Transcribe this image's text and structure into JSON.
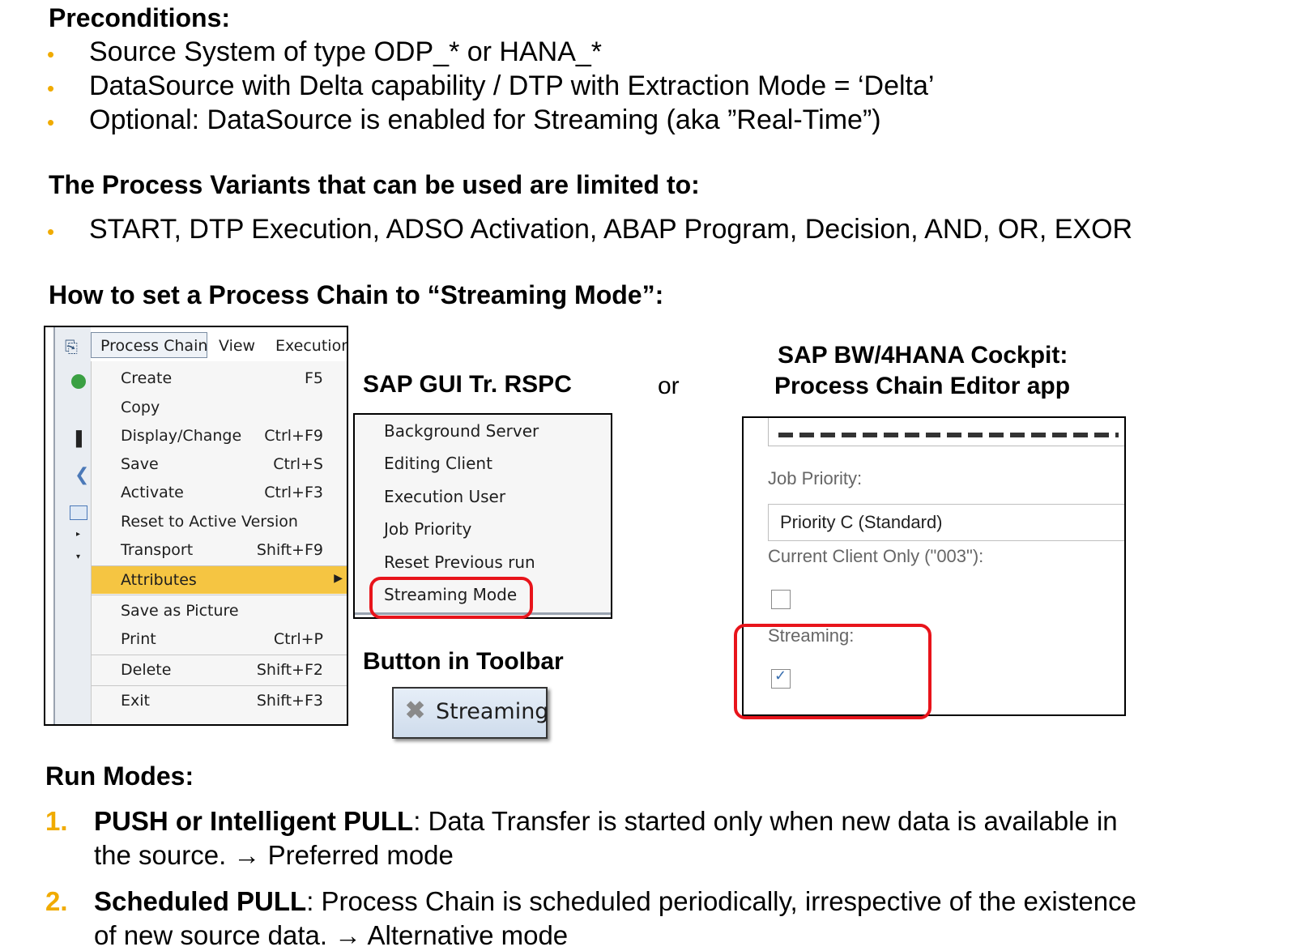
{
  "preconditions": {
    "heading": "Preconditions:",
    "items": [
      "Source System of type ODP_* or HANA_*",
      "DataSource with Delta capability /  DTP with Extraction Mode = ‘Delta’",
      "Optional: DataSource is enabled for Streaming (aka ”Real-Time”)"
    ]
  },
  "variants": {
    "heading": "The Process Variants that can be used are limited to:",
    "items": [
      "START, DTP Execution, ADSO Activation, ABAP Program, Decision, AND, OR, EXOR"
    ]
  },
  "how_to": {
    "heading": "How to set a Process Chain to “Streaming Mode”:"
  },
  "sap_gui": {
    "menubar": [
      "Process Chain",
      "View",
      "Execution"
    ],
    "menu_items": [
      {
        "label": "Create",
        "shortcut": "F5"
      },
      {
        "label": "Copy",
        "shortcut": ""
      },
      {
        "label": "Display/Change",
        "shortcut": "Ctrl+F9"
      },
      {
        "label": "Save",
        "shortcut": "Ctrl+S"
      },
      {
        "label": "Activate",
        "shortcut": "Ctrl+F3"
      },
      {
        "label": "Reset to Active Version",
        "shortcut": ""
      },
      {
        "label": "Transport",
        "shortcut": "Shift+F9"
      },
      {
        "label": "Attributes",
        "shortcut": ""
      },
      {
        "label": "Save as Picture",
        "shortcut": ""
      },
      {
        "label": "Print",
        "shortcut": "Ctrl+P"
      },
      {
        "label": "Delete",
        "shortcut": "Shift+F2"
      },
      {
        "label": "Exit",
        "shortcut": "Shift+F3"
      }
    ],
    "selected_item": "Attributes",
    "title": "SAP GUI Tr. RSPC",
    "submenu_items": [
      "Background Server",
      "Editing Client",
      "Execution User",
      "Job Priority",
      "Reset Previous run",
      "Streaming Mode"
    ],
    "highlighted_submenu": "Streaming Mode"
  },
  "or_text": "or",
  "toolbar": {
    "heading": "Button in Toolbar",
    "button_label": "Streaming",
    "button_icon": "streaming-x-icon"
  },
  "cockpit": {
    "title_line1": "SAP BW/4HANA Cockpit:",
    "title_line2": "Process Chain Editor app",
    "job_priority_label": "Job Priority:",
    "job_priority_value": "Priority C (Standard)",
    "current_client_label": "Current Client Only (\"003\"):",
    "current_client_checked": false,
    "streaming_label": "Streaming:",
    "streaming_checked": true
  },
  "run_modes": {
    "heading": "Run Modes:",
    "items": [
      {
        "num": "1.",
        "title": "PUSH or Intelligent  PULL",
        "line1": ": Data Transfer is started only when new data is available in",
        "line2": "the source. → Preferred mode"
      },
      {
        "num": "2.",
        "title": "Scheduled PULL",
        "line1": ": Process Chain is scheduled periodically,  irrespective of the existence",
        "line2": "of new source data. → Alternative mode"
      }
    ]
  },
  "colors": {
    "accent": "#f0ab00",
    "highlight_red": "#e8141b",
    "menu_selected": "#f5c542"
  }
}
